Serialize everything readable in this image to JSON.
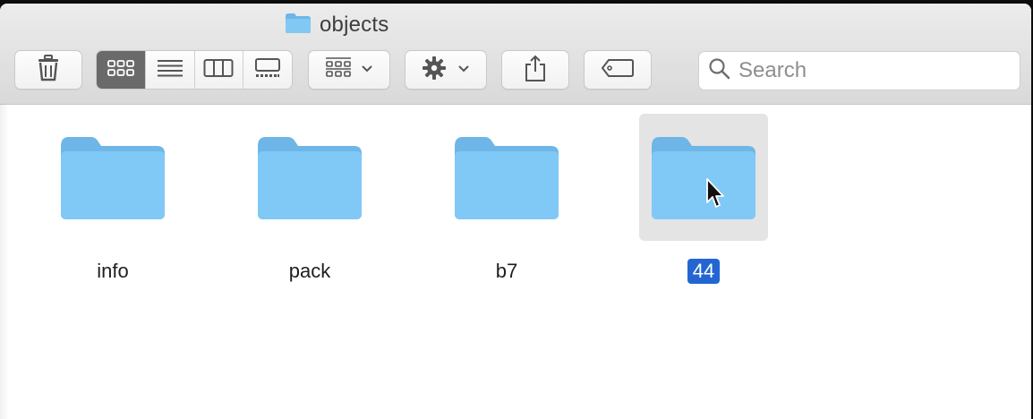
{
  "window": {
    "title": "objects",
    "title_icon": "folder-icon"
  },
  "toolbar": {
    "delete_icon": "trash-icon",
    "view_modes": [
      {
        "name": "icon-view",
        "icon": "grid-icon",
        "active": true
      },
      {
        "name": "list-view",
        "icon": "list-icon",
        "active": false
      },
      {
        "name": "column-view",
        "icon": "columns-icon",
        "active": false
      },
      {
        "name": "gallery-view",
        "icon": "gallery-icon",
        "active": false
      }
    ],
    "arrange_icon": "arrange-grid-icon",
    "action_icon": "gear-icon",
    "share_icon": "share-icon",
    "tag_icon": "tag-icon"
  },
  "search": {
    "placeholder": "Search",
    "value": ""
  },
  "files": [
    {
      "name": "info",
      "selected": false
    },
    {
      "name": "pack",
      "selected": false
    },
    {
      "name": "b7",
      "selected": false
    },
    {
      "name": "44",
      "selected": true
    }
  ],
  "colors": {
    "folder": "#7cc4f4",
    "folder_tab": "#6fb6e8",
    "selection_label": "#2366d1",
    "selection_bg": "#e4e4e4",
    "active_segment": "#6a6a6a"
  }
}
